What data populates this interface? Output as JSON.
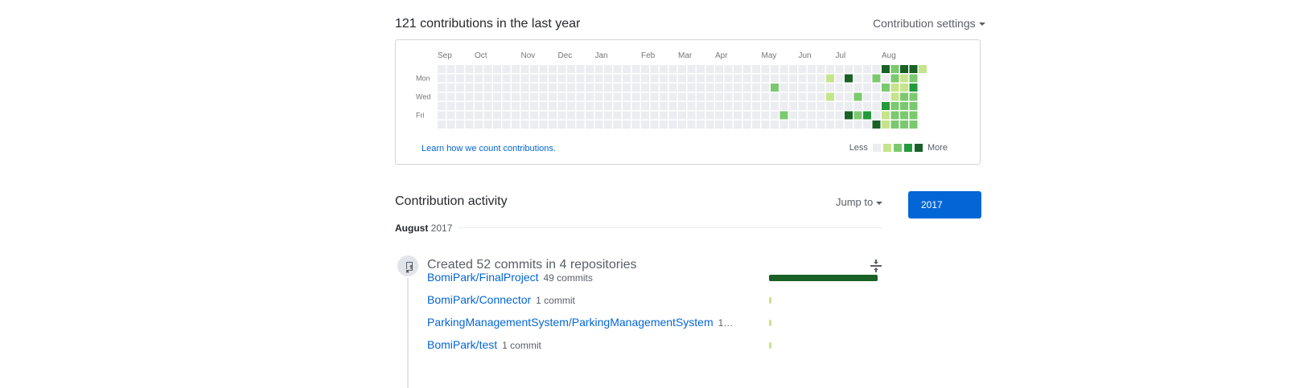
{
  "summary": {
    "heading": "121 contributions in the last year",
    "settings_label": "Contribution settings"
  },
  "calendar": {
    "months": [
      {
        "label": "Sep",
        "week": 0
      },
      {
        "label": "Oct",
        "week": 4
      },
      {
        "label": "Nov",
        "week": 9
      },
      {
        "label": "Dec",
        "week": 13
      },
      {
        "label": "Jan",
        "week": 17
      },
      {
        "label": "Feb",
        "week": 22
      },
      {
        "label": "Mar",
        "week": 26
      },
      {
        "label": "Apr",
        "week": 30
      },
      {
        "label": "May",
        "week": 35
      },
      {
        "label": "Jun",
        "week": 39
      },
      {
        "label": "Jul",
        "week": 43
      },
      {
        "label": "Aug",
        "week": 48
      }
    ],
    "day_labels": [
      {
        "label": "Mon",
        "day": 1
      },
      {
        "label": "Wed",
        "day": 3
      },
      {
        "label": "Fri",
        "day": 5
      }
    ],
    "colors": [
      "#ebedf0",
      "#c6e48b",
      "#7bc96f",
      "#239a3b",
      "#196127"
    ],
    "weeks": 53,
    "last_week_days": 1,
    "activity": [
      {
        "week": 36,
        "day": 2,
        "level": 2
      },
      {
        "week": 37,
        "day": 5,
        "level": 2
      },
      {
        "week": 42,
        "day": 1,
        "level": 1
      },
      {
        "week": 42,
        "day": 3,
        "level": 1
      },
      {
        "week": 44,
        "day": 1,
        "level": 4
      },
      {
        "week": 44,
        "day": 5,
        "level": 4
      },
      {
        "week": 45,
        "day": 3,
        "level": 2
      },
      {
        "week": 45,
        "day": 5,
        "level": 2
      },
      {
        "week": 46,
        "day": 5,
        "level": 3
      },
      {
        "week": 47,
        "day": 1,
        "level": 2
      },
      {
        "week": 47,
        "day": 6,
        "level": 4
      },
      {
        "week": 48,
        "day": 0,
        "level": 4
      },
      {
        "week": 48,
        "day": 2,
        "level": 2
      },
      {
        "week": 48,
        "day": 4,
        "level": 3
      },
      {
        "week": 48,
        "day": 5,
        "level": 1
      },
      {
        "week": 48,
        "day": 6,
        "level": 1
      },
      {
        "week": 49,
        "day": 0,
        "level": 2
      },
      {
        "week": 49,
        "day": 1,
        "level": 2
      },
      {
        "week": 49,
        "day": 2,
        "level": 1
      },
      {
        "week": 49,
        "day": 3,
        "level": 1
      },
      {
        "week": 49,
        "day": 4,
        "level": 2
      },
      {
        "week": 49,
        "day": 5,
        "level": 2
      },
      {
        "week": 49,
        "day": 6,
        "level": 2
      },
      {
        "week": 50,
        "day": 0,
        "level": 4
      },
      {
        "week": 50,
        "day": 1,
        "level": 1
      },
      {
        "week": 50,
        "day": 2,
        "level": 1
      },
      {
        "week": 50,
        "day": 3,
        "level": 2
      },
      {
        "week": 50,
        "day": 4,
        "level": 2
      },
      {
        "week": 50,
        "day": 5,
        "level": 2
      },
      {
        "week": 50,
        "day": 6,
        "level": 2
      },
      {
        "week": 51,
        "day": 0,
        "level": 4
      },
      {
        "week": 51,
        "day": 1,
        "level": 2
      },
      {
        "week": 51,
        "day": 2,
        "level": 3
      },
      {
        "week": 51,
        "day": 3,
        "level": 2
      },
      {
        "week": 51,
        "day": 4,
        "level": 2
      },
      {
        "week": 51,
        "day": 5,
        "level": 2
      },
      {
        "week": 51,
        "day": 6,
        "level": 2
      },
      {
        "week": 52,
        "day": 0,
        "level": 1
      }
    ],
    "learn_link": "Learn how we count contributions.",
    "legend_less": "Less",
    "legend_more": "More"
  },
  "activity": {
    "title": "Contribution activity",
    "jump_label": "Jump to",
    "year_button": "2017",
    "month_name": "August",
    "month_year": "2017",
    "commits_title": "Created 52 commits in 4 repositories",
    "bar_color": "#196127",
    "bar_color_small": "#c6e48b",
    "max_commits": 49,
    "repos": [
      {
        "name": "BomiPark/FinalProject",
        "count": "49 commits",
        "commits": 49
      },
      {
        "name": "BomiPark/Connector",
        "count": "1 commit",
        "commits": 1
      },
      {
        "name": "ParkingManagementSystem/ParkingManagementSystem",
        "count": "1…",
        "commits": 1
      },
      {
        "name": "BomiPark/test",
        "count": "1 commit",
        "commits": 1
      }
    ]
  }
}
